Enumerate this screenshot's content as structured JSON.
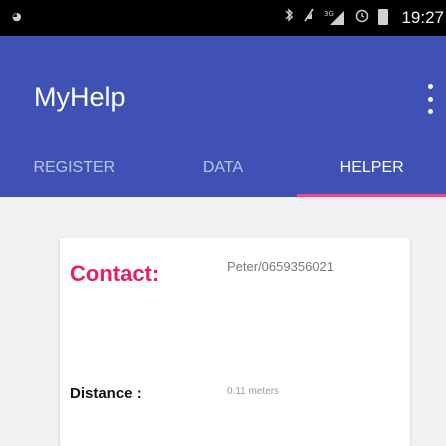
{
  "status_bar": {
    "time": "19:27",
    "left_icon": "notification-icon",
    "icons": [
      "bluetooth-icon",
      "mute-icon",
      "network-signal-icon",
      "alarm-icon",
      "battery-icon"
    ],
    "network_type": "3G"
  },
  "app_bar": {
    "title": "MyHelp",
    "menu_icon": "overflow-menu-icon",
    "color": "#3f51b5",
    "indicator_color": "#ff4081"
  },
  "tabs": [
    {
      "label": "REGISTER",
      "active": false
    },
    {
      "label": "DATA",
      "active": false
    },
    {
      "label": "HELPER",
      "active": true
    }
  ],
  "card": {
    "contact_label": "Contact:",
    "contact_value": "Peter/0659356021",
    "distance_label": "Distance :",
    "distance_value": "0.11 meters",
    "accent_color": "#e91e63"
  }
}
